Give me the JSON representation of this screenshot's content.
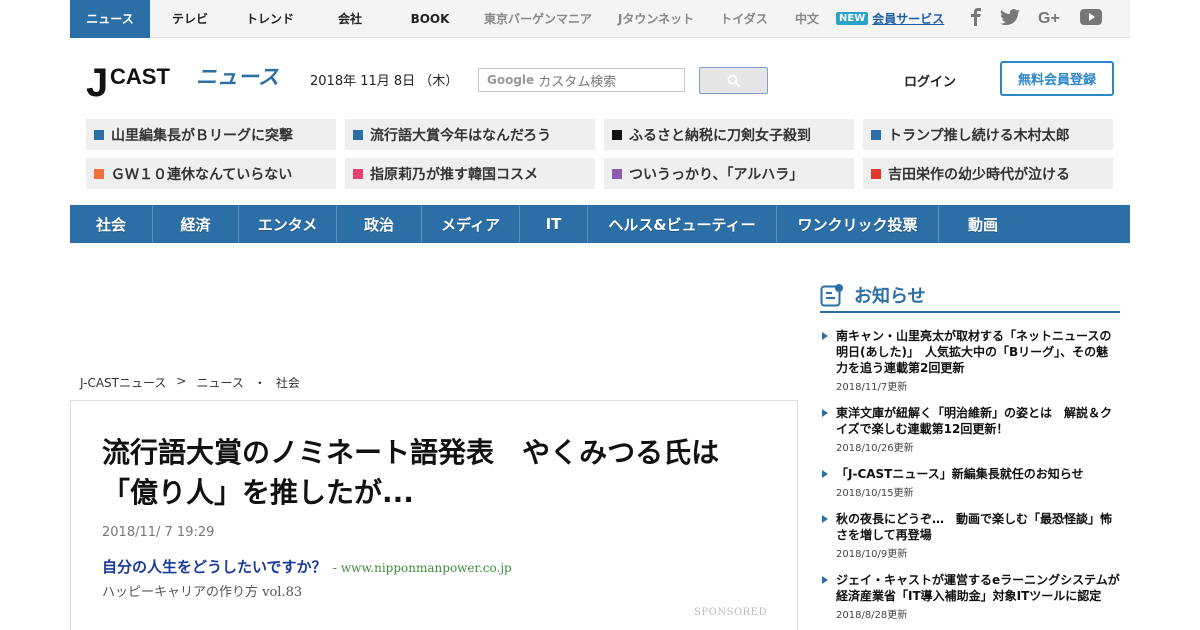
{
  "topnav": {
    "items": [
      {
        "label": "ニュース",
        "style": "active"
      },
      {
        "label": "テレビ",
        "style": "normal"
      },
      {
        "label": "トレンド",
        "style": "normal"
      },
      {
        "label": "会社",
        "style": "normal"
      },
      {
        "label": "BOOK",
        "style": "normal"
      },
      {
        "label": "東京バーゲンマニア",
        "style": "gray"
      },
      {
        "label": "Jタウンネット",
        "style": "gray"
      },
      {
        "label": "トイダス",
        "style": "gray"
      },
      {
        "label": "中文",
        "style": "gray"
      }
    ],
    "new_badge": "NEW",
    "member_service": "会員サービス",
    "social_icons": [
      "facebook-icon",
      "twitter-icon",
      "google-plus-icon",
      "youtube-icon"
    ]
  },
  "header": {
    "logo_j": "J",
    "logo_cast": "CAST",
    "logo_news": "ニュース",
    "date": "2018年 11月 8日 （木）",
    "search_brand": "Google",
    "search_placeholder": "カスタム検索",
    "login": "ログイン",
    "register": "無料会員登録"
  },
  "topics": [
    {
      "label": "山里編集長がＢリーグに突撃",
      "color": "#2c6fa6"
    },
    {
      "label": "流行語大賞今年はなんだろう",
      "color": "#2c6fa6"
    },
    {
      "label": "ふるさと納税に刀剣女子殺到",
      "color": "#111111"
    },
    {
      "label": "トランプ推し続ける木村太郎",
      "color": "#2c6fa6"
    },
    {
      "label": "ＧＷ１０連休なんていらない",
      "color": "#f07040"
    },
    {
      "label": "指原莉乃が推す韓国コスメ",
      "color": "#e8406a"
    },
    {
      "label": "ついうっかり、「アルハラ」",
      "color": "#8e5bb0"
    },
    {
      "label": "吉田栄作の幼少時代が泣ける",
      "color": "#e03a2e"
    }
  ],
  "categories": [
    {
      "label": "社会",
      "w": 83
    },
    {
      "label": "経済",
      "w": 86
    },
    {
      "label": "エンタメ",
      "w": 98
    },
    {
      "label": "政治",
      "w": 85
    },
    {
      "label": "メディア",
      "w": 98
    },
    {
      "label": "IT",
      "w": 68
    },
    {
      "label": "ヘルス&ビューティー",
      "w": 189
    },
    {
      "label": "ワンクリック投票",
      "w": 162
    },
    {
      "label": "動画",
      "w": 88
    }
  ],
  "breadcrumb": [
    "J-CASTニュース",
    ">",
    "ニュース",
    "・",
    "社会"
  ],
  "article": {
    "headline": "流行語大賞のノミネート語発表　やくみつる氏は「億り人」を推したが...",
    "date": "2018/11/ 7 19:29",
    "ad_title": "自分の人生をどうしたいですか？",
    "ad_sep": "-",
    "ad_url": "www.nipponmanpower.co.jp",
    "ad_sub": "ハッピーキャリアの作り方 vol.83",
    "sponsored": "SPONSORED"
  },
  "notice": {
    "title": "お知らせ",
    "items": [
      {
        "text": "南キャン・山里亮太が取材する「ネットニュースの明日(あした)」　人気拡大中の「Bリーグ」、その魅力を追う連載第2回更新",
        "date": "2018/11/7更新"
      },
      {
        "text": "東洋文庫が紐解く「明治維新」の姿とは　解説＆クイズで楽しむ連載第12回更新！",
        "date": "2018/10/26更新"
      },
      {
        "text": "「J-CASTニュース」新編集長就任のお知らせ",
        "date": "2018/10/15更新"
      },
      {
        "text": "秋の夜長にどうぞ…　動画で楽しむ「最恐怪談」怖さを増して再登場",
        "date": "2018/10/9更新"
      },
      {
        "text": "ジェイ・キャストが運営するeラーニングシステムが経済産業省「IT導入補助金」対象ITツールに認定",
        "date": "2018/8/28更新"
      }
    ]
  },
  "colors": {
    "brand_blue": "#2c6fa6",
    "accent_blue": "#2c86c7"
  }
}
